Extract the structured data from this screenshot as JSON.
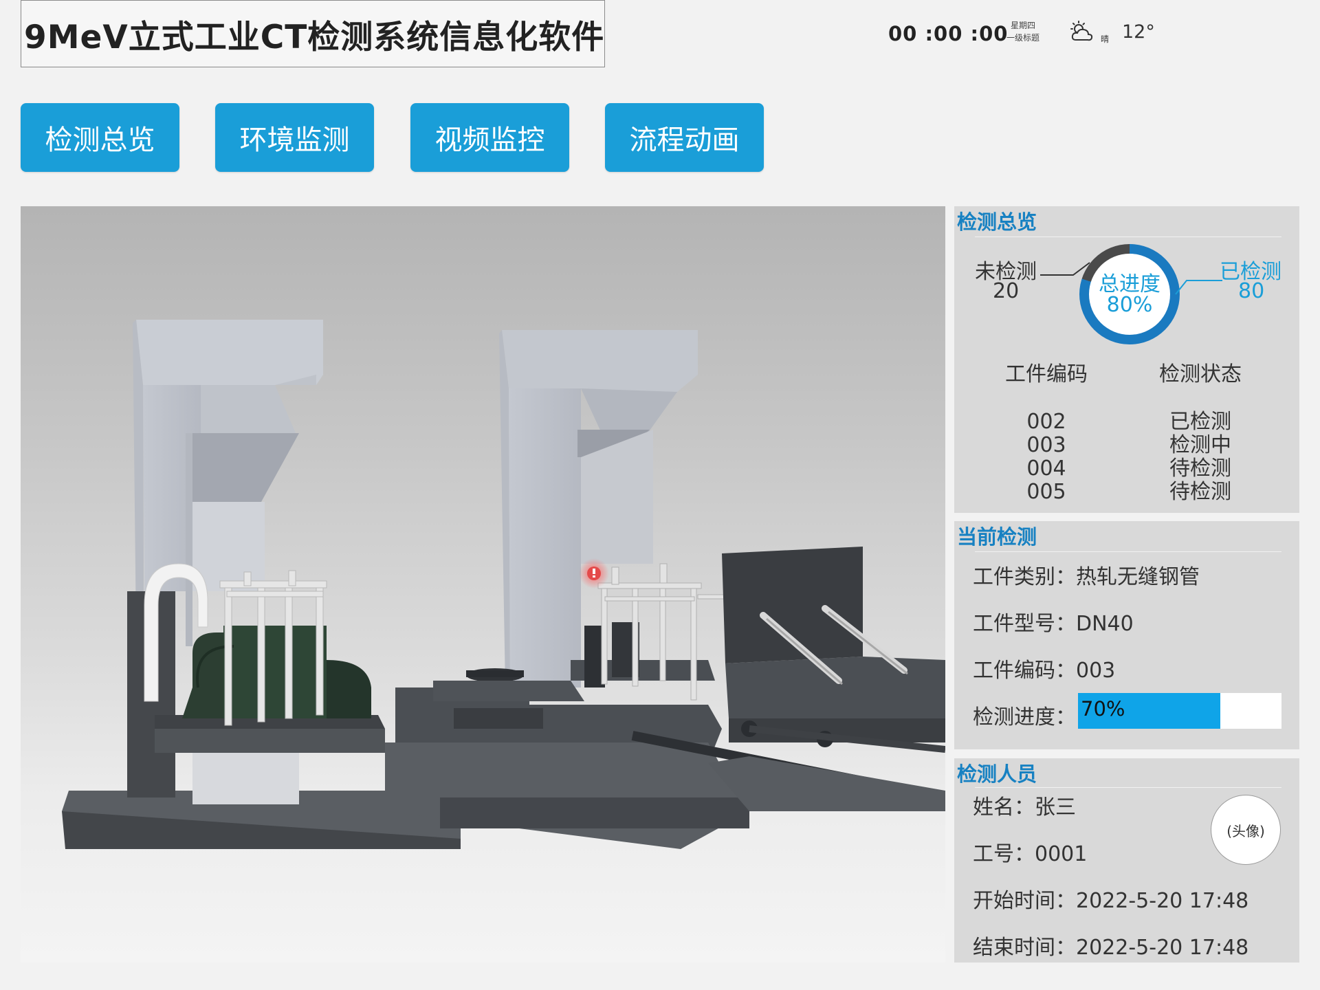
{
  "app": {
    "title": "9MeV立式工业CT检测系统信息化软件"
  },
  "header": {
    "clock": "00 :00 :00",
    "weekday": "星期四",
    "subtitle": "一级标题",
    "weather_icon": "partly-cloudy-icon",
    "weather_text": "晴",
    "temperature": "12°"
  },
  "nav": {
    "items": [
      {
        "label": "检测总览"
      },
      {
        "label": "环境监测"
      },
      {
        "label": "视频监控"
      },
      {
        "label": "流程动画"
      }
    ]
  },
  "overview": {
    "title": "检测总览",
    "untested_label": "未检测",
    "untested_count": "20",
    "tested_label": "已检测",
    "tested_count": "80",
    "progress_label": "总进度",
    "progress_text": "80%",
    "progress_value": 0.8,
    "table": {
      "headers": [
        "工件编码",
        "检测状态"
      ],
      "rows": [
        [
          "002",
          "已检测"
        ],
        [
          "003",
          "检测中"
        ],
        [
          "004",
          "待检测"
        ],
        [
          "005",
          "待检测"
        ]
      ]
    }
  },
  "current": {
    "title": "当前检测",
    "category_label": "工件类别：",
    "category": "热轧无缝钢管",
    "model_label": "工件型号：",
    "model": "DN40",
    "code_label": "工件编码：",
    "code": "003",
    "progress_label": "检测进度：",
    "progress_text": "70%",
    "progress_value": 0.7
  },
  "personnel": {
    "title": "检测人员",
    "name_label": "姓名：",
    "name": "张三",
    "id_label": "工号：",
    "id": "0001",
    "start_label": "开始时间：",
    "start": "2022-5-20 17:48",
    "end_label": "结束时间：",
    "end": "2022-5-20 17:48",
    "avatar_text": "(头像)"
  },
  "colors": {
    "accent": "#1a9ed8",
    "panel_title": "#1781c2",
    "panel_bg": "#d9d9d9",
    "progress_fill": "#0fa4e8"
  }
}
